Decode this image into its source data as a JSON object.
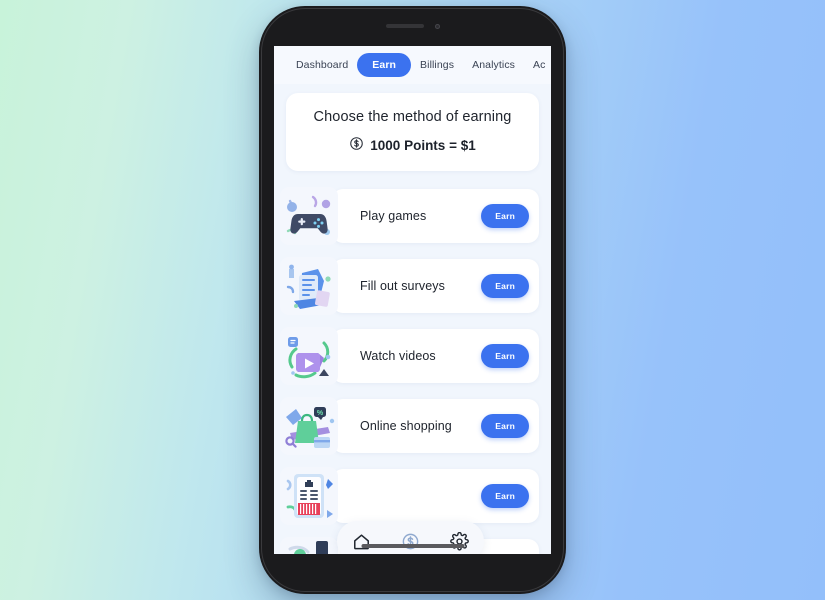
{
  "background": {
    "from": "#c8f3da",
    "to": "#93bffa"
  },
  "theme": {
    "accent": "#3b72ef",
    "screen_bg": "#f1f6fd",
    "card_bg": "#ffffff",
    "text": "#20252e"
  },
  "phone": {
    "speaker_icon": "speaker-grille",
    "camera_icon": "front-camera"
  },
  "tabs": [
    {
      "label": "Dashboard",
      "active": false
    },
    {
      "label": "Earn",
      "active": true
    },
    {
      "label": "Billings",
      "active": false
    },
    {
      "label": "Analytics",
      "active": false
    },
    {
      "label": "Ac",
      "active": false
    }
  ],
  "header": {
    "title": "Choose the method of earning",
    "rate": "1000 Points = $1",
    "coin_icon": "dollar-circle-icon"
  },
  "list": [
    {
      "label": "Play games",
      "thumb": "game-controller-illustration",
      "button": "Earn"
    },
    {
      "label": "Fill out surveys",
      "thumb": "survey-clipboard-illustration",
      "button": "Earn"
    },
    {
      "label": "Watch videos",
      "thumb": "video-play-illustration",
      "button": "Earn"
    },
    {
      "label": "Online shopping",
      "thumb": "shopping-bag-illustration",
      "button": "Earn"
    },
    {
      "label": "",
      "thumb": "receipt-illustration",
      "button": "Earn"
    },
    {
      "label": "",
      "thumb": "partial-illustration",
      "button": ""
    }
  ],
  "bottom_nav": [
    {
      "icon": "home-icon",
      "active": false
    },
    {
      "icon": "dollar-circle-icon",
      "active": true
    },
    {
      "icon": "gear-icon",
      "active": false
    }
  ]
}
